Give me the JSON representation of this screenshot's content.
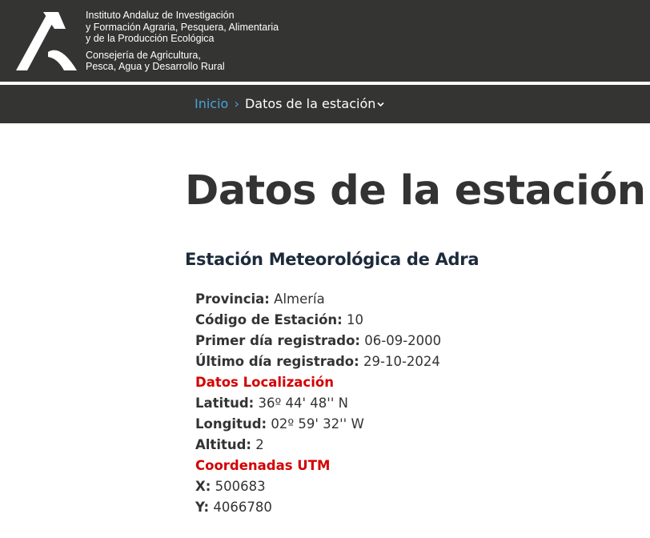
{
  "header": {
    "institute_lines": [
      "Instituto Andaluz de Investigación",
      "y Formación Agraria, Pesquera, Alimentaria",
      "y de la Producción Ecológica"
    ],
    "consejeria_lines": [
      "Consejería de Agricultura,",
      "Pesca, Agua y Desarrollo Rural"
    ]
  },
  "breadcrumb": {
    "home": "Inicio",
    "separator": "›",
    "current": "Datos de la estación"
  },
  "page": {
    "title": "Datos de la estación",
    "station_name": "Estación Meteorológica de Adra"
  },
  "details": {
    "provincia": {
      "label": "Provincia:",
      "value": "Almería"
    },
    "codigo": {
      "label": "Código de Estación:",
      "value": "10"
    },
    "primer_dia": {
      "label": "Primer día registrado:",
      "value": "06-09-2000"
    },
    "ultimo_dia": {
      "label": "Último día registrado:",
      "value": "29-10-2024"
    },
    "localizacion_heading": "Datos Localización",
    "latitud": {
      "label": "Latitud:",
      "value": "36º 44' 48'' N"
    },
    "longitud": {
      "label": "Longitud:",
      "value": "02º 59' 32'' W"
    },
    "altitud": {
      "label": "Altitud:",
      "value": "2"
    },
    "utm_heading": "Coordenadas UTM",
    "x": {
      "label": "X:",
      "value": "500683"
    },
    "y": {
      "label": "Y:",
      "value": "4066780"
    }
  },
  "colors": {
    "header_bg": "#343433",
    "link_blue": "#4aa3d6",
    "section_red": "#d40000",
    "station_name": "#1d2b3c",
    "text": "#333333"
  }
}
